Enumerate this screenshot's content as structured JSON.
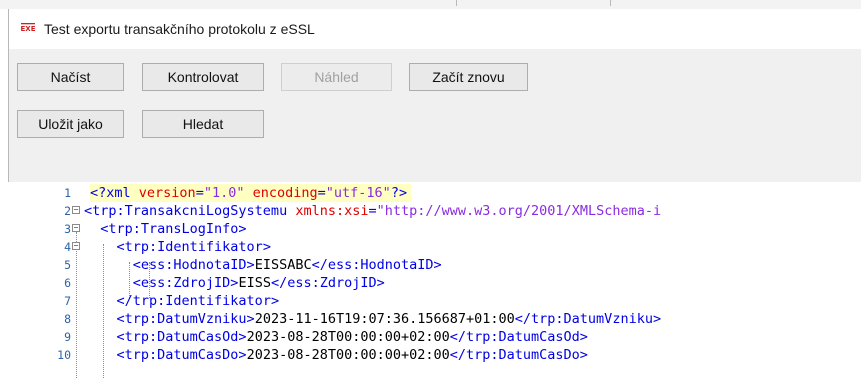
{
  "window": {
    "title": "Test exportu transakčního protokolu z eSSL",
    "icon": "exe-app-icon"
  },
  "toolbar": {
    "load_label": "Načíst",
    "check_label": "Kontrolovat",
    "preview_label": "Náhled",
    "restart_label": "Začít znovu",
    "save_as_label": "Uložit jako",
    "find_label": "Hledat"
  },
  "editor": {
    "highlight_color": "#ffffc2",
    "lines": [
      {
        "num": "1",
        "tokens": [
          [
            "bl",
            "<?xml "
          ],
          [
            "rd",
            "version"
          ],
          [
            "bl",
            "="
          ],
          [
            "pu",
            "\"1.0\""
          ],
          [
            "bl",
            " "
          ],
          [
            "rd",
            "encoding"
          ],
          [
            "bl",
            "="
          ],
          [
            "pu",
            "\"utf-16\""
          ],
          [
            "bl",
            "?>"
          ]
        ]
      },
      {
        "num": "2",
        "tokens": [
          [
            "bl",
            "<trp:TransakcniLogSystemu "
          ],
          [
            "rd",
            "xmlns:xsi"
          ],
          [
            "bl",
            "="
          ],
          [
            "pu",
            "\"http://www.w3.org/2001/XMLSchema-i"
          ]
        ]
      },
      {
        "num": "3",
        "tokens": [
          [
            "bl",
            "<trp:TransLogInfo>"
          ]
        ]
      },
      {
        "num": "4",
        "tokens": [
          [
            "bl",
            "<trp:Identifikator>"
          ]
        ]
      },
      {
        "num": "5",
        "tokens": [
          [
            "bl",
            "<ess:HodnotaID>"
          ],
          [
            "bk",
            "EISSABC"
          ],
          [
            "bl",
            "</ess:HodnotaID>"
          ]
        ]
      },
      {
        "num": "6",
        "tokens": [
          [
            "bl",
            "<ess:ZdrojID>"
          ],
          [
            "bk",
            "EISS"
          ],
          [
            "bl",
            "</ess:ZdrojID>"
          ]
        ]
      },
      {
        "num": "7",
        "tokens": [
          [
            "bl",
            "</trp:Identifikator>"
          ]
        ]
      },
      {
        "num": "8",
        "tokens": [
          [
            "bl",
            "<trp:DatumVzniku>"
          ],
          [
            "bk",
            "2023-11-16T19:07:36.156687+01:00"
          ],
          [
            "bl",
            "</trp:DatumVzniku>"
          ]
        ]
      },
      {
        "num": "9",
        "tokens": [
          [
            "bl",
            "<trp:DatumCasOd>"
          ],
          [
            "bk",
            "2023-08-28T00:00:00+02:00"
          ],
          [
            "bl",
            "</trp:DatumCasOd>"
          ]
        ]
      },
      {
        "num": "10",
        "tokens": [
          [
            "bl",
            "<trp:DatumCasDo>"
          ],
          [
            "bk",
            "2023-08-28T00:00:00+02:00"
          ],
          [
            "bl",
            "</trp:DatumCasDo>"
          ]
        ]
      }
    ]
  }
}
